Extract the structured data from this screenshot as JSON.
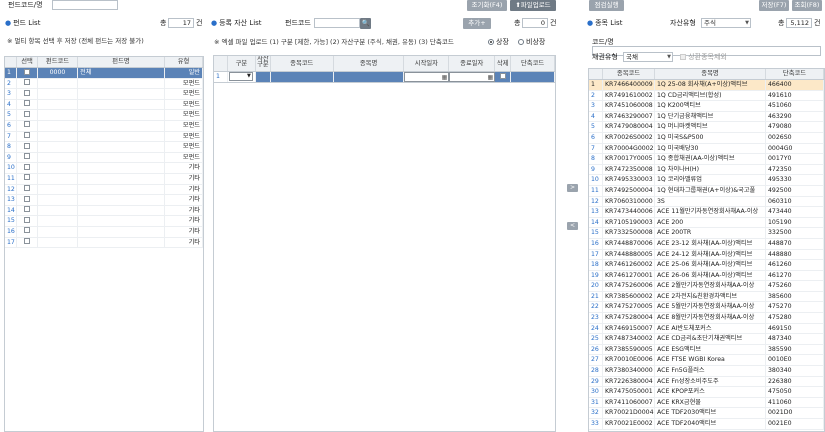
{
  "header": {
    "fund_code_label": "펀드코드/명",
    "btn_inquiry_condition": "조기화(F4)",
    "btn_file_upload": "파일업로드",
    "btn_check_run": "점검실행",
    "btn_save": "저장(F7)",
    "btn_search": "조회(F8)"
  },
  "fund_panel": {
    "title": "펀드 List",
    "total_label": "총",
    "total_value": "17",
    "total_unit": "건",
    "note": "※ 멀티 항목 선택 후 저장 (전체 펀드는 저장 불가)",
    "columns": [
      "선택",
      "펀드코드",
      "펀드명",
      "유형"
    ],
    "rows": [
      {
        "no": "1",
        "code": "0000",
        "name": "전체",
        "type": "일반"
      },
      {
        "no": "2",
        "code": "",
        "name": "",
        "type": "모펀드"
      },
      {
        "no": "3",
        "code": "",
        "name": "",
        "type": "모펀드"
      },
      {
        "no": "4",
        "code": "",
        "name": "",
        "type": "모펀드"
      },
      {
        "no": "5",
        "code": "",
        "name": "",
        "type": "모펀드"
      },
      {
        "no": "6",
        "code": "",
        "name": "",
        "type": "모펀드"
      },
      {
        "no": "7",
        "code": "",
        "name": "",
        "type": "모펀드"
      },
      {
        "no": "8",
        "code": "",
        "name": "",
        "type": "모펀드"
      },
      {
        "no": "9",
        "code": "",
        "name": "",
        "type": "모펀드"
      },
      {
        "no": "10",
        "code": "",
        "name": "",
        "type": "기타"
      },
      {
        "no": "11",
        "code": "",
        "name": "",
        "type": "기타"
      },
      {
        "no": "12",
        "code": "",
        "name": "",
        "type": "기타"
      },
      {
        "no": "13",
        "code": "",
        "name": "",
        "type": "기타"
      },
      {
        "no": "14",
        "code": "",
        "name": "",
        "type": "기타"
      },
      {
        "no": "15",
        "code": "",
        "name": "",
        "type": "기타"
      },
      {
        "no": "16",
        "code": "",
        "name": "",
        "type": "기타"
      },
      {
        "no": "17",
        "code": "",
        "name": "",
        "type": "기타"
      }
    ]
  },
  "asset_panel": {
    "title": "등록 자산 List",
    "fund_code_label": "펀드코드",
    "add_button": "추가+",
    "total_label": "총",
    "total_value": "0",
    "total_unit": "건",
    "note": "※ 엑셀 파일 업로드 (1) 구분 [제한, 가능] (2) 자산구분 (주식, 채권, 유동) (3) 단축코드",
    "radio_listed": "상장",
    "radio_unlisted": "비상장",
    "columns": [
      "구분",
      "자산구분",
      "종목코드",
      "종목명",
      "시작일자",
      "종료일자",
      "삭제",
      "단축코드"
    ]
  },
  "transfer": {
    "right_arrow": ">",
    "left_arrow": "<"
  },
  "stock_panel": {
    "title": "종목 List",
    "asset_type_label": "자산유형",
    "asset_type_value": "주식",
    "total_label": "총",
    "total_value": "5,112",
    "total_unit": "건",
    "code_label": "코드/명",
    "bond_type_label": "채권유형",
    "bond_type_value": "국채",
    "delisted_label": "상환종목제외",
    "columns": [
      "종목코드",
      "종목명",
      "단축코드"
    ],
    "rows": [
      {
        "no": "1",
        "code": "KR7466400009",
        "name": "1Q 25-08 회사채(A+이상)액티브",
        "short": "466400"
      },
      {
        "no": "2",
        "code": "KR7491610002",
        "name": "1Q CD금리액티브(합성)",
        "short": "491610"
      },
      {
        "no": "3",
        "code": "KR7451060008",
        "name": "1Q K200액티브",
        "short": "451060"
      },
      {
        "no": "4",
        "code": "KR7463290007",
        "name": "1Q 단기금융채액티브",
        "short": "463290"
      },
      {
        "no": "5",
        "code": "KR7479080004",
        "name": "1Q 머니마켓액티브",
        "short": "479080"
      },
      {
        "no": "6",
        "code": "KR70026S0002",
        "name": "1Q 미국S&P500",
        "short": "0026S0"
      },
      {
        "no": "7",
        "code": "KR70004G0002",
        "name": "1Q 미국배당30",
        "short": "0004G0"
      },
      {
        "no": "8",
        "code": "KR70017Y0005",
        "name": "1Q 종합채권(AA-이상)액티브",
        "short": "0017Y0"
      },
      {
        "no": "9",
        "code": "KR7472350008",
        "name": "1Q 차이나H(H)",
        "short": "472350"
      },
      {
        "no": "10",
        "code": "KR7495330003",
        "name": "1Q 코리아밸류업",
        "short": "495330"
      },
      {
        "no": "11",
        "code": "KR7492500004",
        "name": "1Q 현대차그룹채권(A+이상)&국고풀",
        "short": "492500"
      },
      {
        "no": "12",
        "code": "KR7060310000",
        "name": "3S",
        "short": "060310"
      },
      {
        "no": "13",
        "code": "KR7473440006",
        "name": "ACE 11월만기자동연장회사채AA-이상",
        "short": "473440"
      },
      {
        "no": "14",
        "code": "KR7105190003",
        "name": "ACE 200",
        "short": "105190"
      },
      {
        "no": "15",
        "code": "KR7332500008",
        "name": "ACE 200TR",
        "short": "332500"
      },
      {
        "no": "16",
        "code": "KR7448870006",
        "name": "ACE 23-12 회사채(AA-이상)액티브",
        "short": "448870"
      },
      {
        "no": "17",
        "code": "KR7448880005",
        "name": "ACE 24-12 회사채(AA-이상)액티브",
        "short": "448880"
      },
      {
        "no": "18",
        "code": "KR7461260002",
        "name": "ACE 25-06 회사채(AA-이상)액티브",
        "short": "461260"
      },
      {
        "no": "19",
        "code": "KR7461270001",
        "name": "ACE 26-06 회사채(AA-이상)액티브",
        "short": "461270"
      },
      {
        "no": "20",
        "code": "KR7475260006",
        "name": "ACE 2월만기자동연장회사채AA-이상",
        "short": "475260"
      },
      {
        "no": "21",
        "code": "KR7385600002",
        "name": "ACE 2차전지&친환경차액티브",
        "short": "385600"
      },
      {
        "no": "22",
        "code": "KR7475270005",
        "name": "ACE 5월만기자동연장회사채AA-이상",
        "short": "475270"
      },
      {
        "no": "23",
        "code": "KR7475280004",
        "name": "ACE 8월만기자동연장회사채AA-이상",
        "short": "475280"
      },
      {
        "no": "24",
        "code": "KR7469150007",
        "name": "ACE AI반도체포커스",
        "short": "469150"
      },
      {
        "no": "25",
        "code": "KR7487340002",
        "name": "ACE CD금리&초단기채권액티브",
        "short": "487340"
      },
      {
        "no": "26",
        "code": "KR7385590005",
        "name": "ACE ESG액티브",
        "short": "385590"
      },
      {
        "no": "27",
        "code": "KR70010E0006",
        "name": "ACE FTSE WGBI Korea",
        "short": "0010E0"
      },
      {
        "no": "28",
        "code": "KR7380340000",
        "name": "ACE Fn5G플러스",
        "short": "380340"
      },
      {
        "no": "29",
        "code": "KR7226380004",
        "name": "ACE Fn성장소비주도주",
        "short": "226380"
      },
      {
        "no": "30",
        "code": "KR7475050001",
        "name": "ACE KPOP포커스",
        "short": "475050"
      },
      {
        "no": "31",
        "code": "KR7411060007",
        "name": "ACE KRX금현물",
        "short": "411060"
      },
      {
        "no": "32",
        "code": "KR70021D0004",
        "name": "ACE TDF2030액티브",
        "short": "0021D0"
      },
      {
        "no": "33",
        "code": "KR70021E0002",
        "name": "ACE TDF2040액티브",
        "short": "0021E0"
      }
    ]
  }
}
